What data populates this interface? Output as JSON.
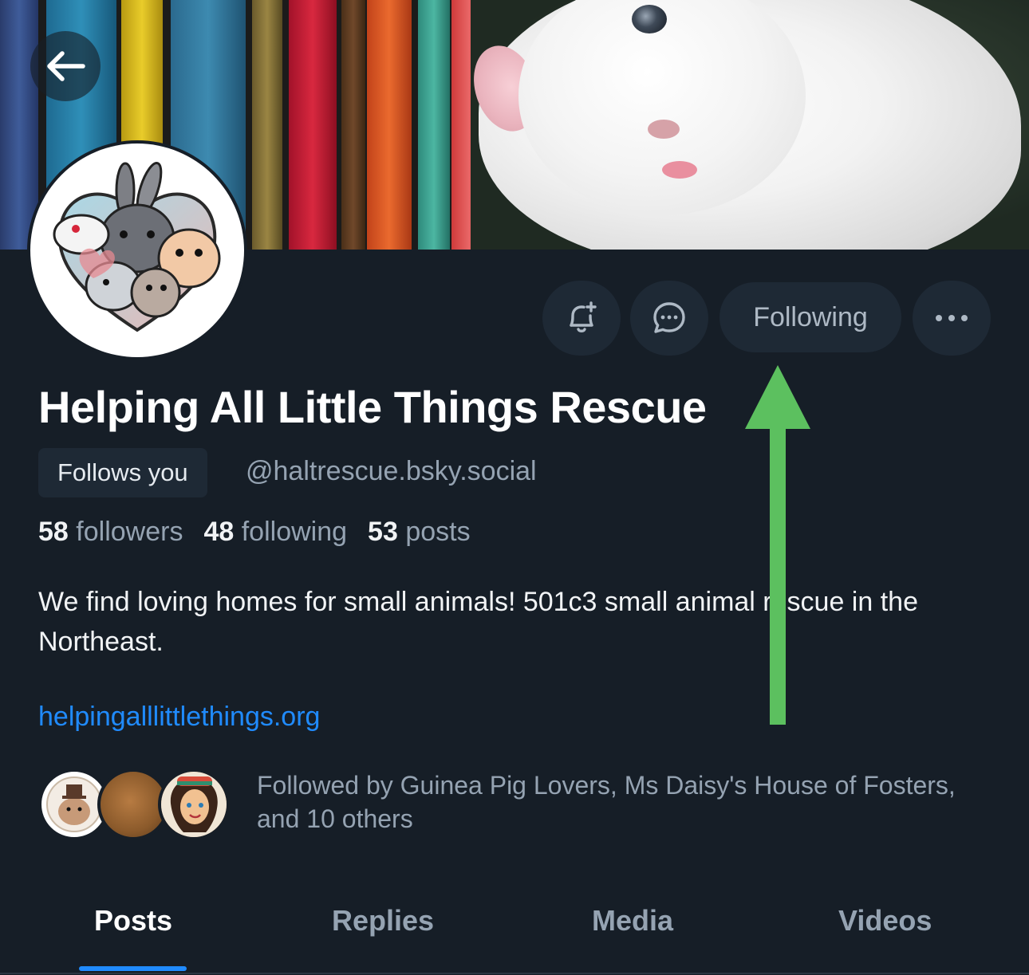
{
  "profile": {
    "display_name": "Helping All Little Things Rescue",
    "follows_you_badge": "Follows you",
    "handle": "@haltrescue.bsky.social",
    "stats": {
      "followers_count": "58",
      "followers_label": "followers",
      "following_count": "48",
      "following_label": "following",
      "posts_count": "53",
      "posts_label": "posts"
    },
    "bio": "We find loving homes for small animals! 501c3 small animal rescue in the Northeast.",
    "website": "helpingalllittlethings.org",
    "followed_by": "Followed by Guinea Pig Lovers, Ms Daisy's House of Fosters, and 10 others"
  },
  "actions": {
    "following_label": "Following",
    "icons": [
      "bell-plus-icon",
      "chat-bubble-icon",
      "ellipsis-icon"
    ]
  },
  "navigation": {
    "back_icon": "arrow-left-icon"
  },
  "tabs": [
    {
      "label": "Posts",
      "active": true
    },
    {
      "label": "Replies",
      "active": false
    },
    {
      "label": "Media",
      "active": false
    },
    {
      "label": "Videos",
      "active": false
    }
  ],
  "colors": {
    "background": "#161e27",
    "button_bg": "#1e2935",
    "link": "#208bfe",
    "muted_text": "#95a3b2",
    "annotation_arrow": "#5cc05f"
  }
}
